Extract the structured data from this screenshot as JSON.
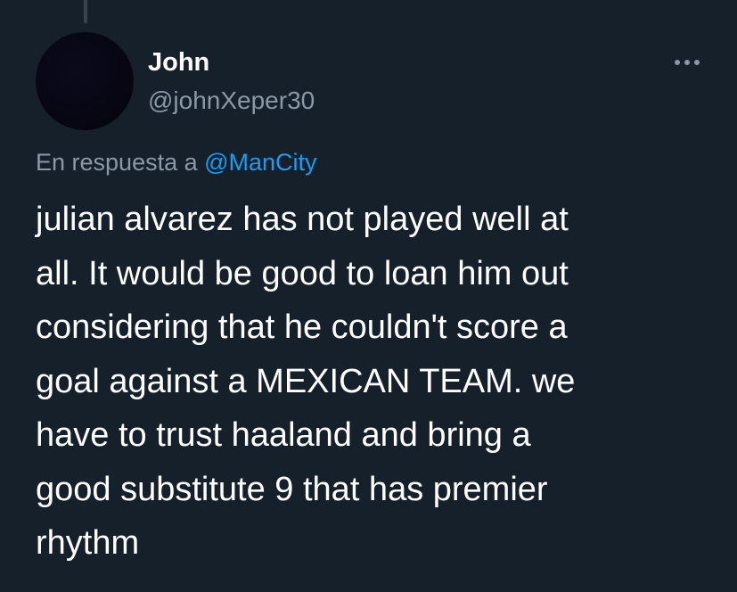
{
  "tweet": {
    "author": {
      "name": "John",
      "handle": "@johnXeper30"
    },
    "more_icon": "more-horizontal-icon",
    "reply": {
      "prefix": "En respuesta a ",
      "mention": "@ManCity"
    },
    "text_lines": [
      "julian alvarez has not played well at",
      "all. It would be good to loan him out",
      "considering that he couldn't score a",
      "goal against a MEXICAN TEAM. we",
      "have to trust haaland and bring a",
      "good substitute 9 that has premier",
      "rhythm"
    ]
  },
  "colors": {
    "background": "#15202b",
    "primary_text": "#ffffff",
    "secondary_text": "#8b98a5",
    "accent": "#1d9bf0"
  }
}
